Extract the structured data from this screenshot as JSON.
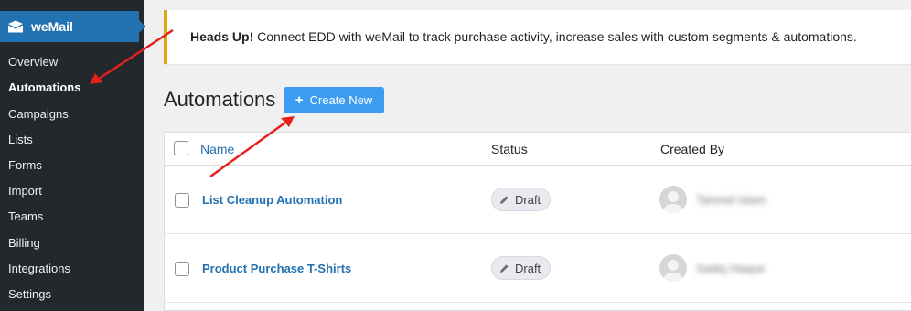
{
  "sidebar": {
    "brand_label": "weMail",
    "items": [
      {
        "label": "Overview",
        "active": false
      },
      {
        "label": "Automations",
        "active": true
      },
      {
        "label": "Campaigns",
        "active": false
      },
      {
        "label": "Lists",
        "active": false
      },
      {
        "label": "Forms",
        "active": false
      },
      {
        "label": "Import",
        "active": false
      },
      {
        "label": "Teams",
        "active": false
      },
      {
        "label": "Billing",
        "active": false
      },
      {
        "label": "Integrations",
        "active": false
      },
      {
        "label": "Settings",
        "active": false
      }
    ]
  },
  "notice": {
    "strong": "Heads Up!",
    "text": " Connect EDD with weMail to track purchase activity, increase sales with custom segments & automations."
  },
  "header": {
    "title": "Automations",
    "create_label": "Create New"
  },
  "table": {
    "columns": {
      "name": "Name",
      "status": "Status",
      "created_by": "Created By"
    },
    "rows": [
      {
        "name": "List Cleanup Automation",
        "status": "Draft",
        "created_by": "Tahmid Islam"
      },
      {
        "name": "Product Purchase T-Shirts",
        "status": "Draft",
        "created_by": "Sadiq Haque"
      }
    ]
  },
  "colors": {
    "sidebar_bg": "#23282d",
    "brand_bg": "#2271b1",
    "button_bg": "#3c9cf0",
    "notice_border": "#dba617",
    "link": "#2271b1",
    "arrow": "#e5201c"
  },
  "icons": {
    "brand": "envelope-icon",
    "create": "plus-icon",
    "status": "pencil-icon",
    "avatar": "user-avatar-icon"
  }
}
